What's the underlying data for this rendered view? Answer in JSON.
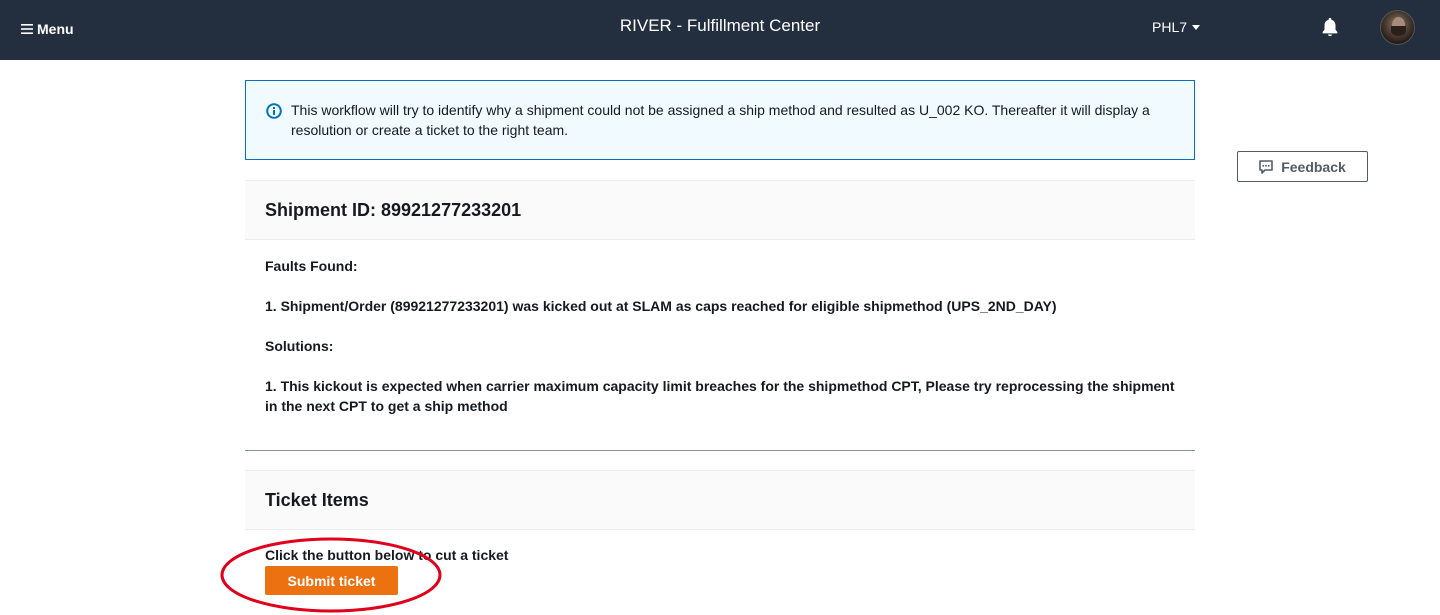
{
  "topbar": {
    "menu_label": "Menu",
    "app_title": "RIVER - Fulfillment Center",
    "site": "PHL7",
    "icons": [
      "hamburger-icon",
      "caret-down-icon",
      "bell-icon",
      "avatar"
    ],
    "background_color": "#232f3e"
  },
  "alert": {
    "icon": "info-icon",
    "text": "This workflow will try to identify why a shipment could not be assigned a ship method and resulted as U_002 KO. Thereafter it will display a resolution or create a ticket to the right team.",
    "border_color": "#0073bb",
    "background_color": "#f1faff"
  },
  "feedback": {
    "label": "Feedback",
    "icon": "feedback-icon"
  },
  "shipment": {
    "title": "Shipment ID: 89921277233201",
    "faults_heading": "Faults Found:",
    "fault_1": "1. Shipment/Order (89921277233201) was kicked out at SLAM as caps reached for eligible shipmethod (UPS_2ND_DAY)",
    "solutions_heading": "Solutions:",
    "solution_1": "1. This kickout is expected when carrier maximum capacity limit breaches for the shipmethod CPT, Please try reprocessing the shipment in the next CPT to get a ship method"
  },
  "tickets": {
    "title": "Ticket Items",
    "instruction": "Click the button below to cut a ticket",
    "submit_label": "Submit ticket",
    "button_color": "#ec7211"
  },
  "annotation": {
    "ring_color": "#e0001b"
  }
}
